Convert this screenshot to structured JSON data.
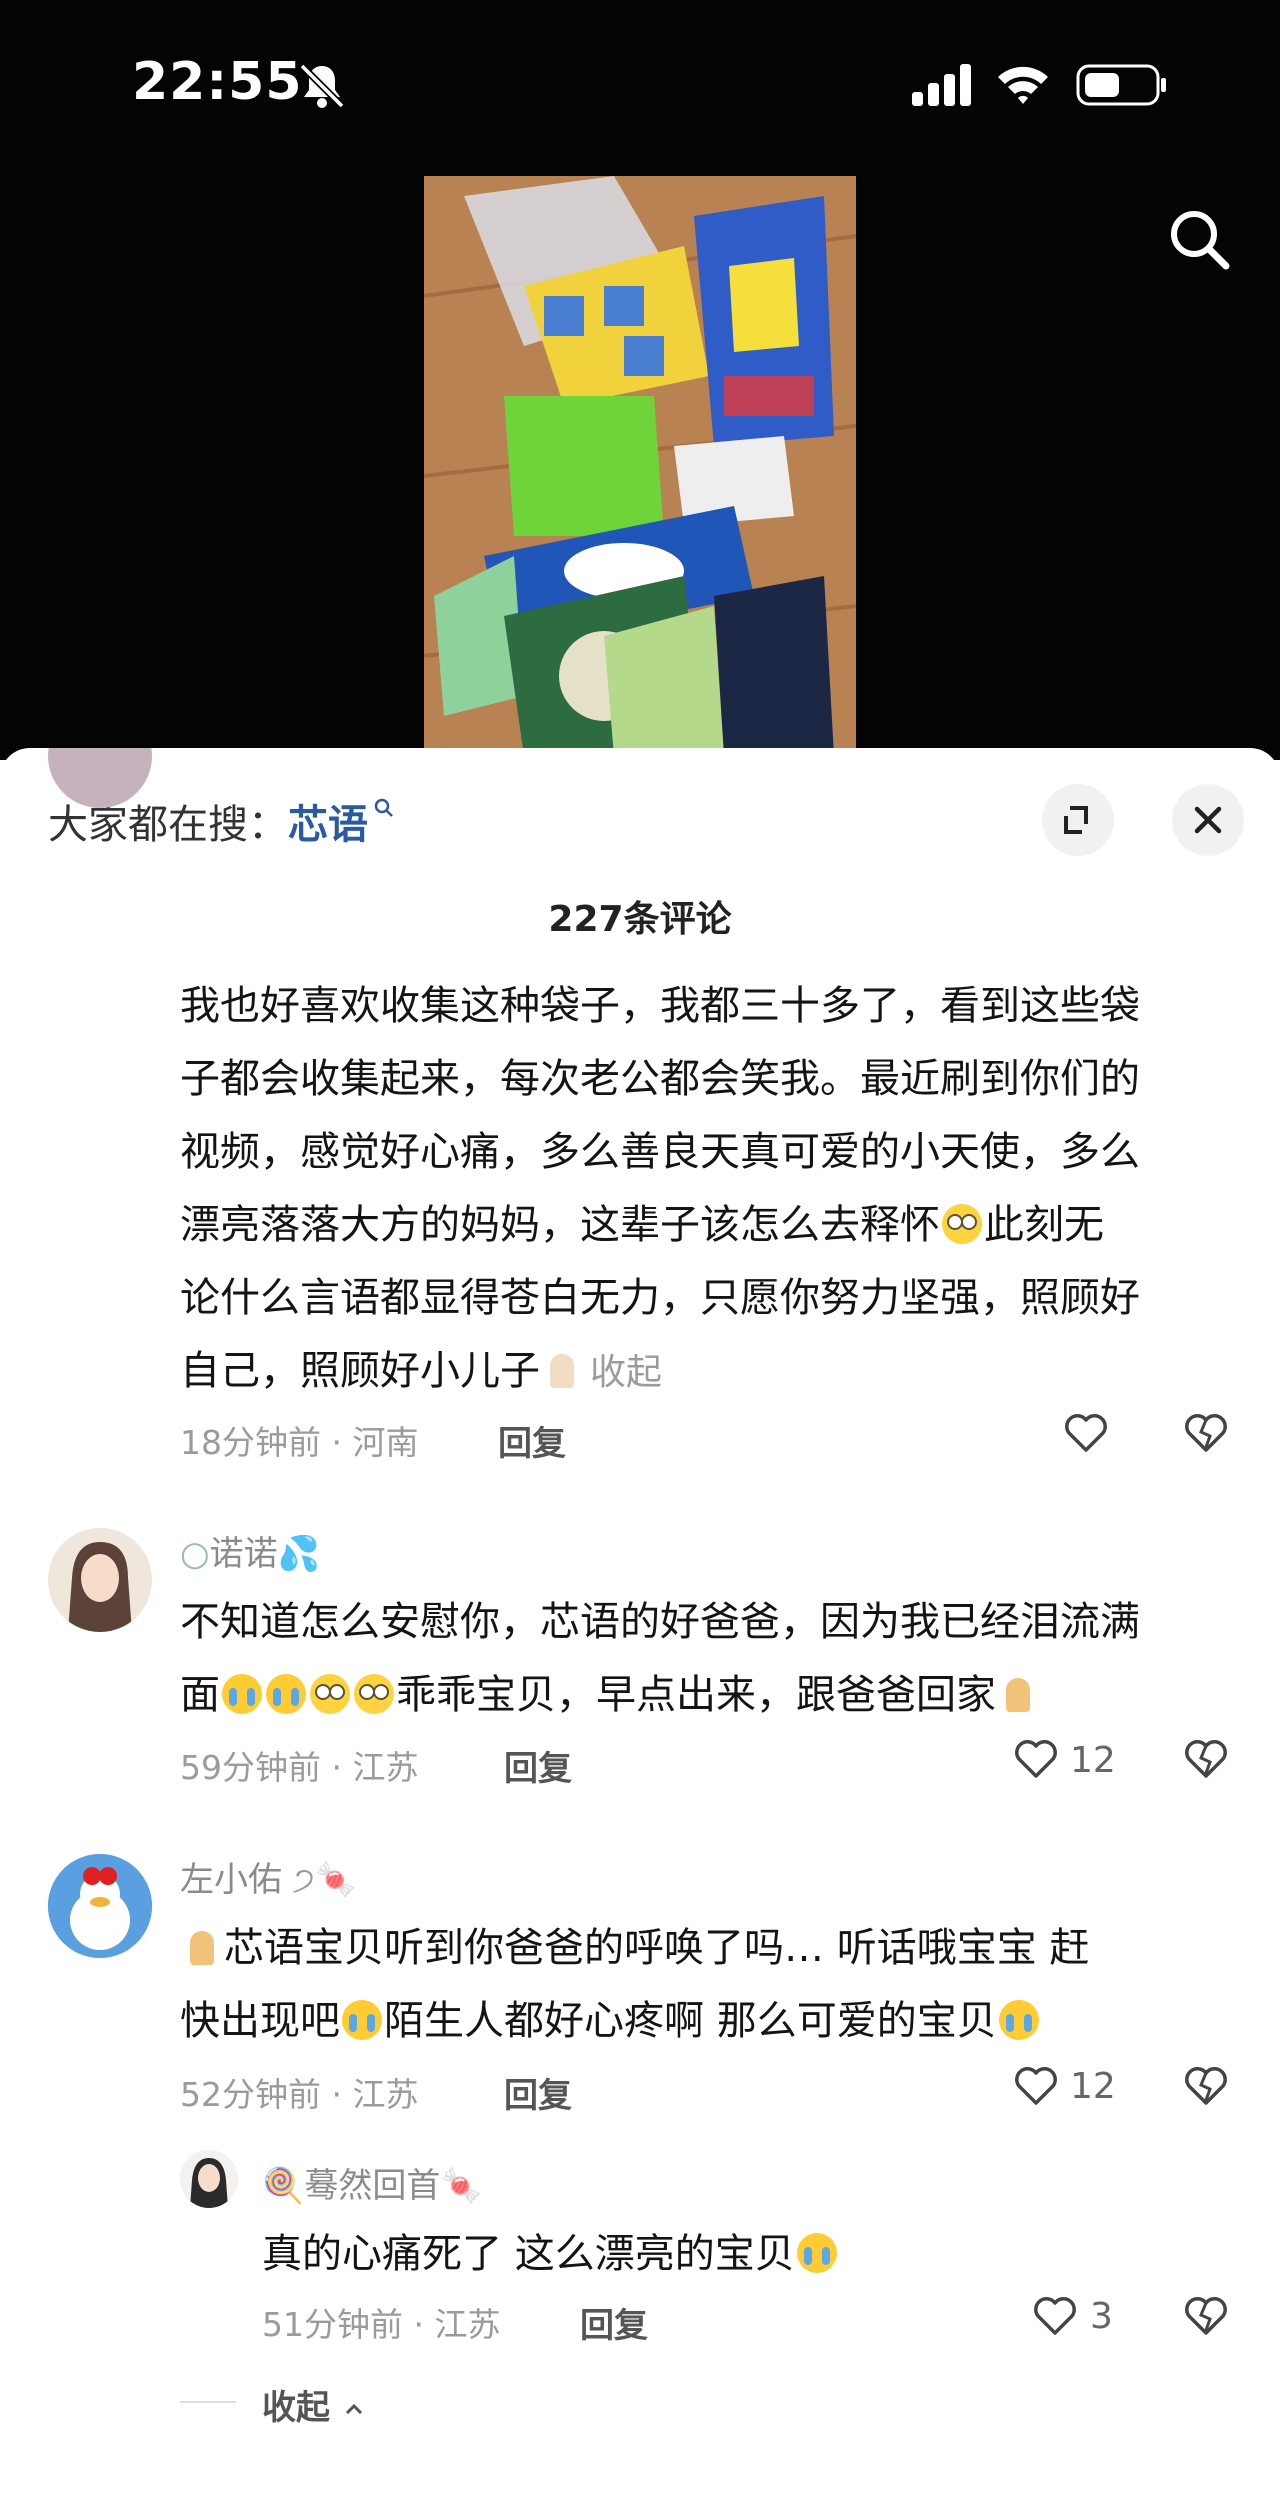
{
  "status_bar": {
    "time": "22:55"
  },
  "sheet": {
    "trending_label": "大家都在搜：",
    "trending_term": "芯语",
    "comment_count": "227条评论",
    "collapse_all": "收起"
  },
  "comments": [
    {
      "text_line1": "我也好喜欢收集这种袋子，我都三十多了，看到这些袋",
      "text_line2": "子都会收集起来，每次老公都会笑我。最近刷到你们的",
      "text_line3": "视频，感觉好心痛，多么善良天真可爱的小天使，多么",
      "text_line4a": "漂亮落落大方的妈妈，这辈子该怎么去释怀",
      "text_line4b": "此刻无",
      "text_line5": "论什么言语都显得苍白无力，只愿你努力坚强，照顾好",
      "text_line6": "自己，照顾好小儿子",
      "collapse_label": "收起",
      "meta": "18分钟前 · 河南",
      "reply_label": "回复",
      "likes": ""
    },
    {
      "username": "诺诺",
      "text_line1": "不知道怎么安慰你，芯语的好爸爸，因为我已经泪流满",
      "text_line2a": "面",
      "text_line2b": "乖乖宝贝，早点出来，跟爸爸回家",
      "meta": "59分钟前 · 江苏",
      "reply_label": "回复",
      "likes": "12"
    },
    {
      "username": "左小佑",
      "text_line1": "芯语宝贝听到你爸爸的呼唤了吗…  听话哦宝宝   赶",
      "text_line2a": "快出现吧",
      "text_line2b": "陌生人都好心疼啊    那么可爱的宝贝",
      "meta": "52分钟前 · 江苏",
      "reply_label": "回复",
      "likes": "12"
    },
    {
      "username": "蓦然回首",
      "text": "真的心痛死了 这么漂亮的宝贝",
      "meta": "51分钟前 · 江苏",
      "reply_label": "回复",
      "likes": "3"
    }
  ],
  "icons": {
    "bell": "bell-slash-icon",
    "search": "search-icon",
    "expand": "expand-icon",
    "close": "close-icon",
    "heart": "heart-icon",
    "dislike": "broken-heart-icon"
  }
}
